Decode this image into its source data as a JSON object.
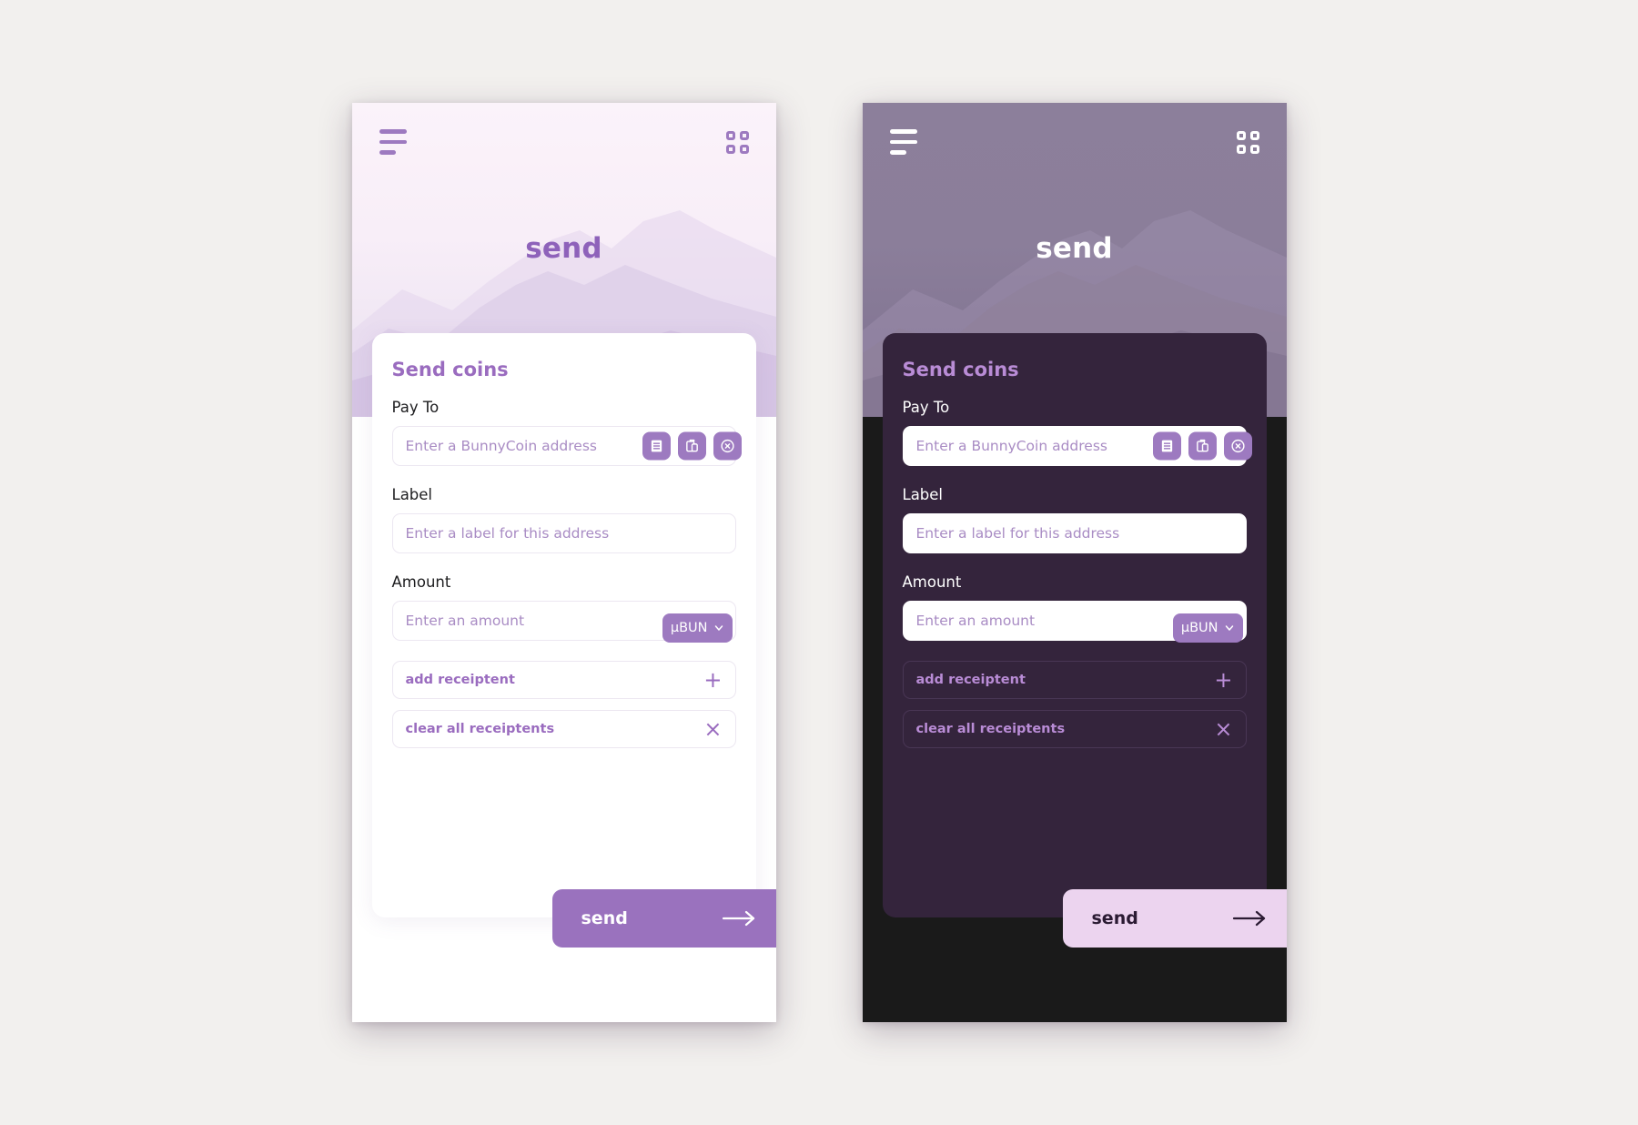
{
  "screens": [
    {
      "theme": "light",
      "topbar": {
        "menu_icon": "hamburger-menu-icon",
        "grid_icon": "grid-apps-icon"
      },
      "hero_title": "send",
      "card": {
        "title": "Send coins",
        "fields": [
          {
            "label": "Pay To",
            "placeholder": "Enter a BunnyCoin address",
            "value": ""
          },
          {
            "label": "Label",
            "placeholder": "Enter a label for this address",
            "value": ""
          },
          {
            "label": "Amount",
            "placeholder": "Enter an amount",
            "value": ""
          }
        ],
        "payto_actions": [
          "address-book-icon",
          "paste-clipboard-icon",
          "clear-circle-x-icon"
        ],
        "currency": {
          "selected": "µBUN",
          "chevron": "chevron-down-icon"
        },
        "actions": [
          {
            "label": "add receiptent",
            "symbol": "+",
            "icon": "plus-icon"
          },
          {
            "label": "clear all receiptents",
            "symbol": "×",
            "icon": "close-x-icon"
          }
        ]
      },
      "cta": {
        "label": "send",
        "icon": "arrow-right-icon"
      }
    },
    {
      "theme": "dark",
      "topbar": {
        "menu_icon": "hamburger-menu-icon",
        "grid_icon": "grid-apps-icon"
      },
      "hero_title": "send",
      "card": {
        "title": "Send coins",
        "fields": [
          {
            "label": "Pay To",
            "placeholder": "Enter a BunnyCoin address",
            "value": ""
          },
          {
            "label": "Label",
            "placeholder": "Enter a label for this address",
            "value": ""
          },
          {
            "label": "Amount",
            "placeholder": "Enter an amount",
            "value": ""
          }
        ],
        "payto_actions": [
          "address-book-icon",
          "paste-clipboard-icon",
          "clear-circle-x-icon"
        ],
        "currency": {
          "selected": "µBUN",
          "chevron": "chevron-down-icon"
        },
        "actions": [
          {
            "label": "add receiptent",
            "symbol": "+",
            "icon": "plus-icon"
          },
          {
            "label": "clear all receiptents",
            "symbol": "×",
            "icon": "close-x-icon"
          }
        ]
      },
      "cta": {
        "label": "send",
        "icon": "arrow-right-icon"
      }
    }
  ],
  "colors": {
    "accent": "#9d7ac0",
    "accent_text_light": "#9a6cbf",
    "accent_text_dark": "#b98cd6",
    "card_dark": "#34243c",
    "phone_dark_bg": "#1a1a1a",
    "cta_light": "#9a72be",
    "cta_dark": "#ecd4ef",
    "placeholder": "#a98cc4"
  }
}
